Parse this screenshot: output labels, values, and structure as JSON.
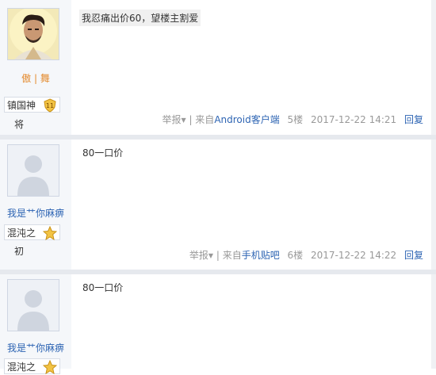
{
  "posts": [
    {
      "username": "傲 | 舞",
      "level_name": "镇国神",
      "level_num": "11",
      "level_suffix": "将",
      "content": "我忍痛出价60，望楼主割爱",
      "report": "举报",
      "source_prefix": "| 来自",
      "source": "Android客户端",
      "floor": "5楼",
      "time": "2017-12-22 14:21",
      "reply": "回复"
    },
    {
      "username": "我是艹你麻痹",
      "level_name": "混沌之",
      "level_suffix": "初",
      "content": "80一口价",
      "report": "举报",
      "source_prefix": "| 来自",
      "source": "手机贴吧",
      "floor": "6楼",
      "time": "2017-12-22 14:22",
      "reply": "回复"
    },
    {
      "username": "我是艹你麻痹",
      "level_name": "混沌之",
      "content": "80一口价"
    }
  ],
  "colors": {
    "link": "#2d64b3",
    "orange": "#e48b2f",
    "gray": "#999999"
  }
}
